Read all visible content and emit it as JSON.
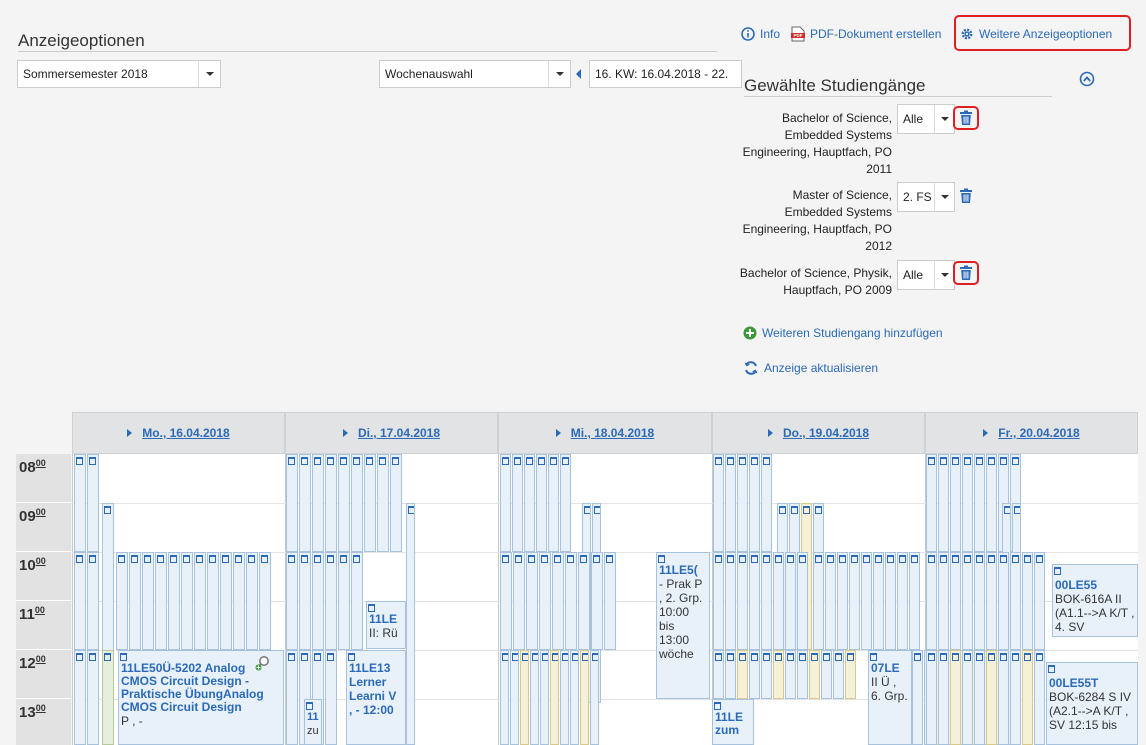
{
  "display_options": {
    "title": "Anzeigeoptionen",
    "semester_select": "Sommersemester 2018",
    "week_mode_select": "Wochenauswahl",
    "week_select": "16. KW: 16.04.2018 - 22."
  },
  "top_actions": {
    "info": "Info",
    "pdf": "PDF-Dokument erstellen",
    "more_options": "Weitere Anzeigeoptionen"
  },
  "study_programs": {
    "title": "Gewählte Studiengänge",
    "items": [
      {
        "label": "Bachelor of Science, Embedded Systems Engineering, Hauptfach, PO 2011",
        "select": "Alle"
      },
      {
        "label": "Master of Science, Embedded Systems Engineering, Hauptfach, PO 2012",
        "select": "2. FS"
      },
      {
        "label": "Bachelor of Science, Physik, Hauptfach, PO 2009",
        "select": "Alle"
      }
    ],
    "add_program": "Weiteren Studiengang hinzufügen",
    "refresh": "Anzeige aktualisieren"
  },
  "calendar": {
    "days": [
      "Mo., 16.04.2018",
      "Di., 17.04.2018",
      "Mi., 18.04.2018",
      "Do., 19.04.2018",
      "Fr., 20.04.2018"
    ],
    "hours": [
      "08",
      "09",
      "10",
      "11",
      "12",
      "13"
    ],
    "hour_suffix": "00",
    "events": [
      {
        "title": "11LE50Ü-5202 Analog CMOS Circuit Design - Praktische ÜbungAnalog CMOS Circuit Design",
        "details": "P , -"
      },
      {
        "title": "11LE13",
        "details": "Lerner Learni V , - 12:00"
      },
      {
        "title": "11LE5(",
        "details": "- Prak P , 2. Grp. 10:00 bis 13:00 wöche"
      },
      {
        "title": "00LE55",
        "details": "BOK-616A II (A1.1-->A K/T , 4. SV"
      },
      {
        "title": "00LE55T",
        "details": "BOK-6284 S IV (A2.1-->A K/T , SV 12:15 bis"
      },
      {
        "title": "07LE",
        "details": "II Ü , 6. Grp."
      },
      {
        "title": "11LE",
        "details": "zum"
      },
      {
        "title": "11LE",
        "details": "II: Rü"
      },
      {
        "title": "11",
        "details": "zu"
      }
    ]
  }
}
